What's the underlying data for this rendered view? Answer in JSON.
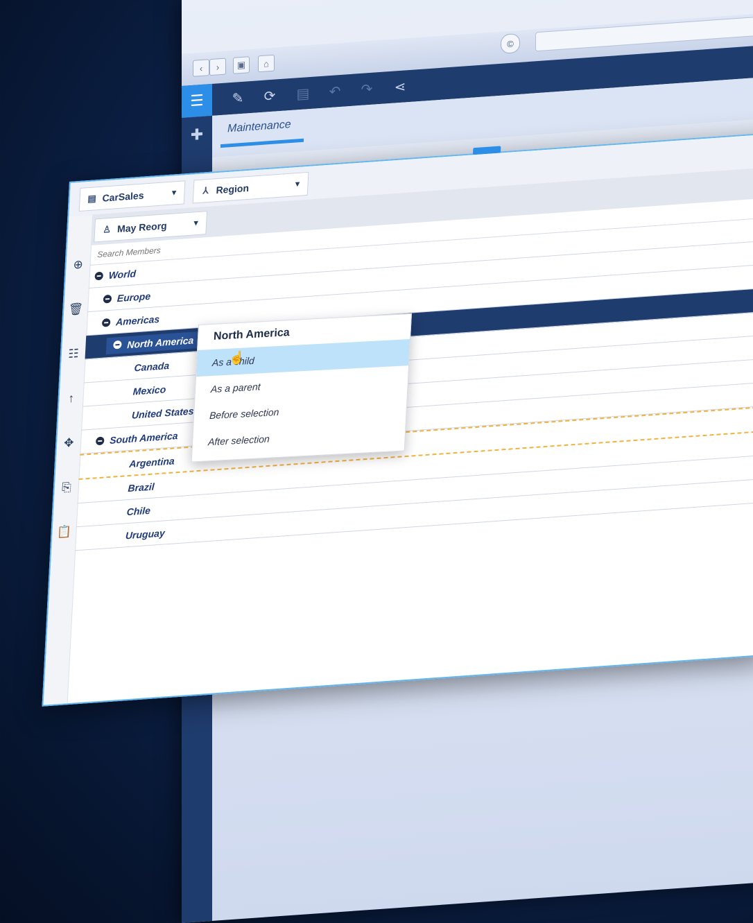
{
  "browser": {
    "url_icon": "copyright-icon",
    "nav_icons": [
      "back-icon",
      "forward-icon",
      "window-icon",
      "home-icon"
    ]
  },
  "toolbar": {
    "icons": [
      "menu-icon",
      "pencil-icon",
      "refresh-icon",
      "save-icon",
      "undo-icon",
      "redo-icon",
      "share-icon"
    ]
  },
  "tabs": [
    {
      "label": "Maintenance"
    }
  ],
  "panel": {
    "cube_dropdown": "CarSales",
    "dimension_dropdown": "Region",
    "hierarchy_dropdown": "May Reorg",
    "search_placeholder": "Search Members"
  },
  "tree": [
    {
      "label": "World",
      "level": 0,
      "expandable": true
    },
    {
      "label": "Europe",
      "level": 1,
      "expandable": true
    },
    {
      "label": "Americas",
      "level": 1,
      "expandable": true
    },
    {
      "label": "North America",
      "level": 2,
      "expandable": true,
      "selected": true
    },
    {
      "label": "Canada",
      "level": 3,
      "expandable": false
    },
    {
      "label": "Mexico",
      "level": 3,
      "expandable": false
    },
    {
      "label": "United States",
      "level": 3,
      "expandable": false
    },
    {
      "label": "South America",
      "level": 1,
      "expandable": true
    },
    {
      "label": "Argentina",
      "level": 2,
      "expandable": false,
      "dropzone": true
    },
    {
      "label": "Brazil",
      "level": 2,
      "expandable": false
    },
    {
      "label": "Chile",
      "level": 2,
      "expandable": false
    },
    {
      "label": "Uruguay",
      "level": 2,
      "expandable": false
    }
  ],
  "context_menu": {
    "title": "North America",
    "items": [
      "As a child",
      "As a parent",
      "Before selection",
      "After selection"
    ],
    "hovered_index": 0
  },
  "colors": {
    "toolbar": "#1f3c6e",
    "accent": "#2d8ee8",
    "selected_row": "#2a5296",
    "menu_hover": "#bfe2fb",
    "dropzone": "#f3b13a"
  }
}
